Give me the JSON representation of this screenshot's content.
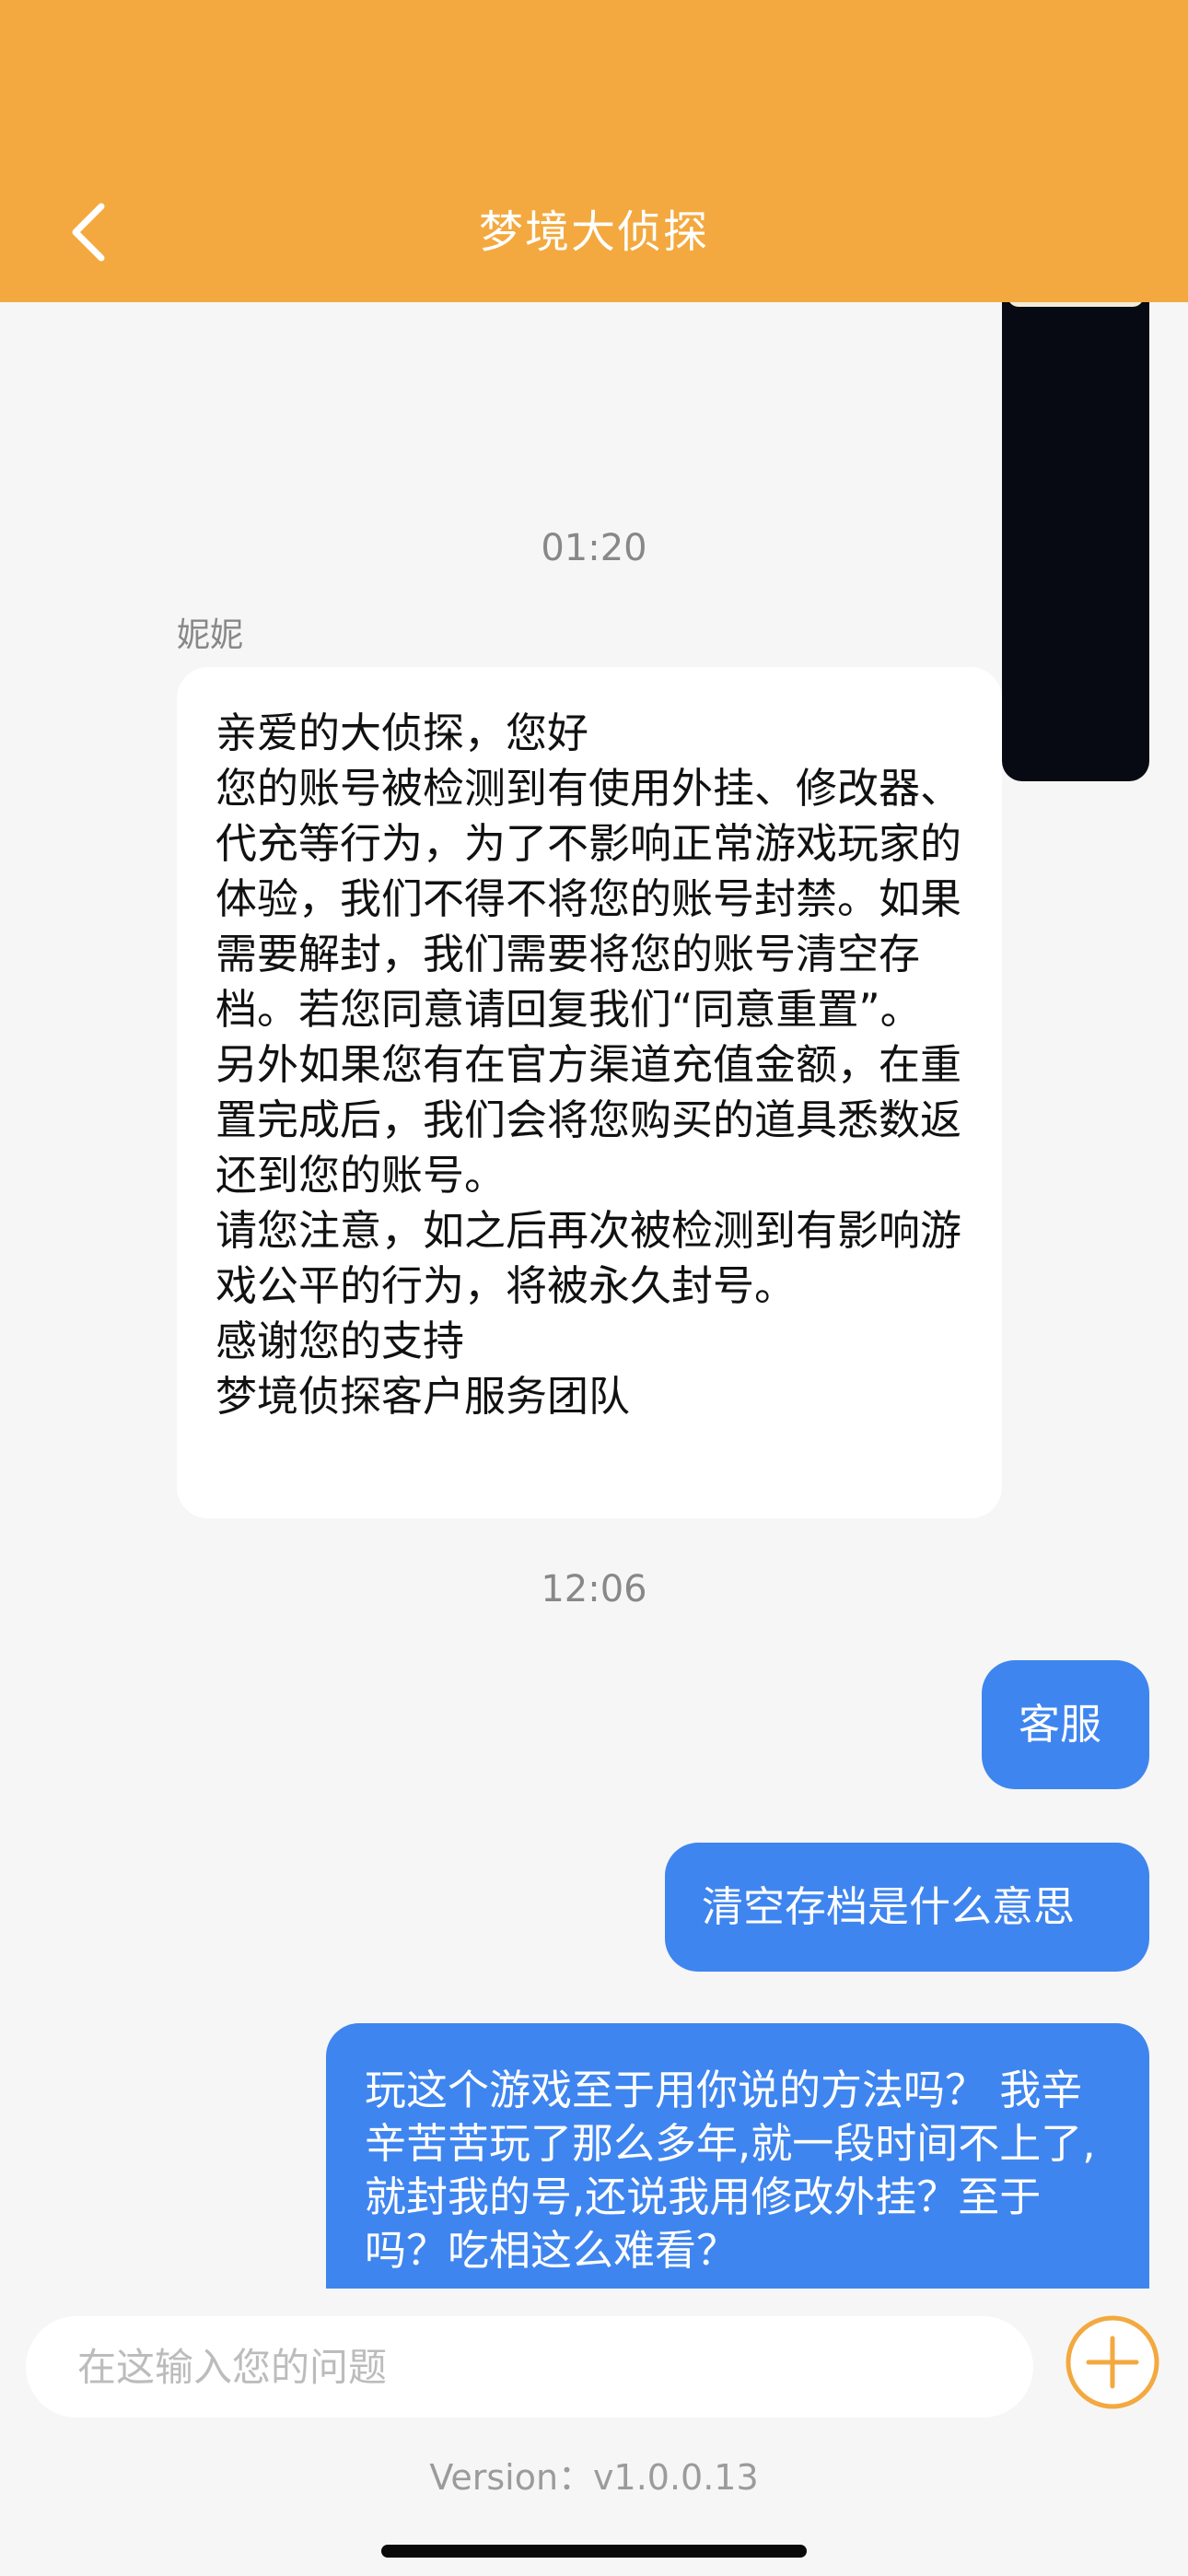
{
  "header": {
    "title": "梦境大侦探",
    "back_icon": "chevron-left-icon",
    "background_color": "#f3a93f"
  },
  "messages": {
    "time_1": "01:20",
    "sender_name": "妮妮",
    "incoming_text": "亲爱的大侦探，您好\n您的账号被检测到有使用外挂、修改器、代充等行为，为了不影响正常游戏玩家的体验，我们不得不将您的账号封禁。如果需要解封，我们需要将您的账号清空存档。若您同意请回复我们“同意重置”。\n另外如果您有在官方渠道充值金额，在重置完成后，我们会将您购买的道具悉数返还到您的账号。\n请您注意，如之后再次被检测到有影响游戏公平的行为，将被永久封号。\n感谢您的支持\n梦境侦探客户服务团队",
    "time_2": "12:06",
    "outgoing": [
      "客服",
      "清空存档是什么意思",
      "玩这个游戏至于用你说的方法吗？ 我辛辛苦苦玩了那么多年,就一段时间不上了,就封我的号,还说我用修改外挂？至于吗？吃相这么难看？"
    ],
    "outgoing_bubble_color": "#3f85ef"
  },
  "input": {
    "placeholder": "在这输入您的问题",
    "add_icon": "plus-circle-icon",
    "accent_color": "#f3a93f"
  },
  "footer": {
    "version": "Version：v1.0.0.13"
  }
}
